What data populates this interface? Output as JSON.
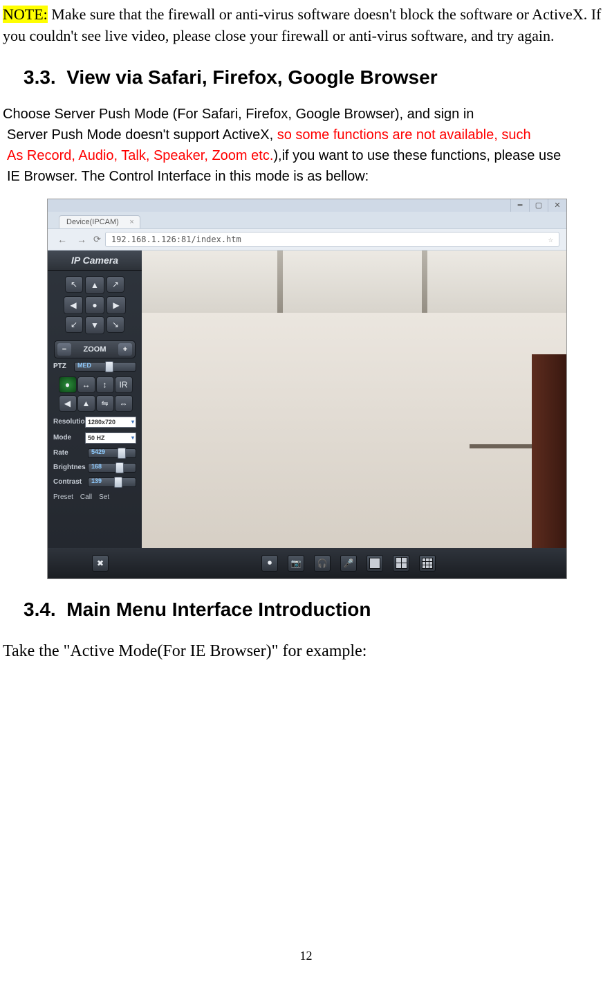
{
  "note": {
    "label": "NOTE:",
    "text": " Make sure that the firewall or anti-virus software doesn't block the software or ActiveX. If you couldn't see live video, please close your firewall or anti-virus software, and try again."
  },
  "section33": {
    "num": "3.3.",
    "title": "View via Safari, Firefox, Google Browser",
    "p1": "Choose Server Push Mode (For Safari, Firefox, Google Browser), and sign in",
    "p2a": "Server Push Mode doesn't support ActiveX, ",
    "p2red": "so some functions are not available, such",
    "p3red": "As Record, Audio, Talk, Speaker, Zoom etc.",
    "p3b": "),if you want to use these functions, please use",
    "p4": "IE Browser. The Control Interface in this mode is as bellow:"
  },
  "browser": {
    "tab_title": "Device(IPCAM)",
    "url": "192.168.1.126:81/index.htm"
  },
  "side": {
    "title": "IP Camera",
    "zoom_label": "ZOOM",
    "ptz_label": "PTZ",
    "ptz_speed": "MED",
    "ir_label": "IR",
    "resolution": {
      "label": "Resolutio",
      "value": "1280x720"
    },
    "mode": {
      "label": "Mode",
      "value": "50 HZ"
    },
    "rate": {
      "label": "Rate",
      "value": "5429"
    },
    "brightness": {
      "label": "Brightnes",
      "value": "168"
    },
    "contrast": {
      "label": "Contrast",
      "value": "139"
    },
    "preset": {
      "label": "Preset",
      "call": "Call",
      "set": "Set"
    }
  },
  "section34": {
    "num": "3.4.",
    "title": "Main Menu Interface Introduction",
    "example": "Take the \"Active Mode(For IE Browser)\" for example:"
  },
  "page_num": "12"
}
